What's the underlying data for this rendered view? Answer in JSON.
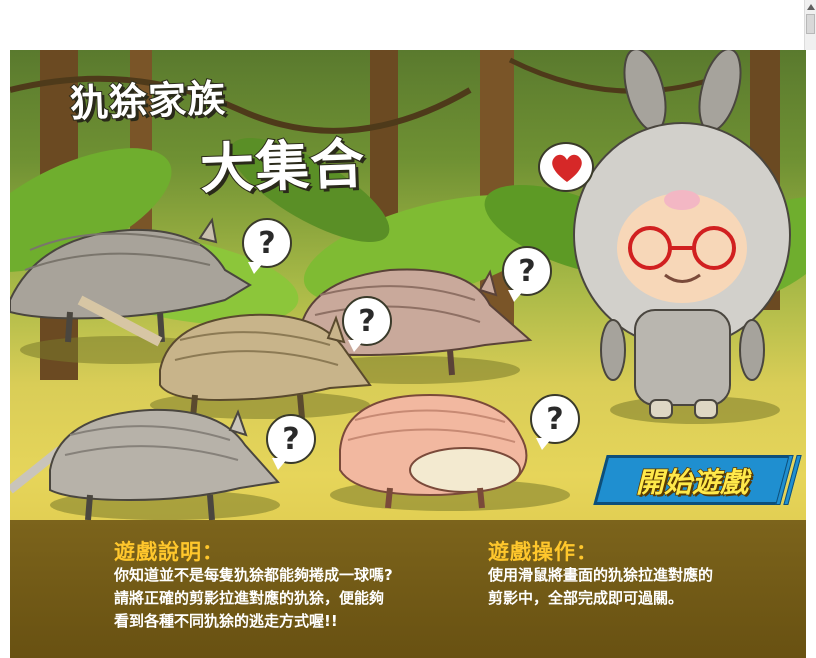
{
  "title": {
    "line1": "犰狳家族",
    "line2": "大集合"
  },
  "bubbles": {
    "question_mark": "?"
  },
  "start_button": {
    "label": "開始遊戲"
  },
  "instructions": {
    "title": "遊戲說明：",
    "body": "你知道並不是每隻犰狳都能夠捲成一球嗎?\n請將正確的剪影拉進對應的犰狳，便能夠\n看到各種不同犰狳的逃走方式喔!!"
  },
  "controls": {
    "title": "遊戲操作：",
    "body": "使用滑鼠將畫面的犰狳拉進對應的\n剪影中，全部完成即可過關。"
  },
  "colors": {
    "accent_yellow": "#ffc72c",
    "button_blue": "#1f8fd0",
    "heart_red": "#d62828"
  }
}
